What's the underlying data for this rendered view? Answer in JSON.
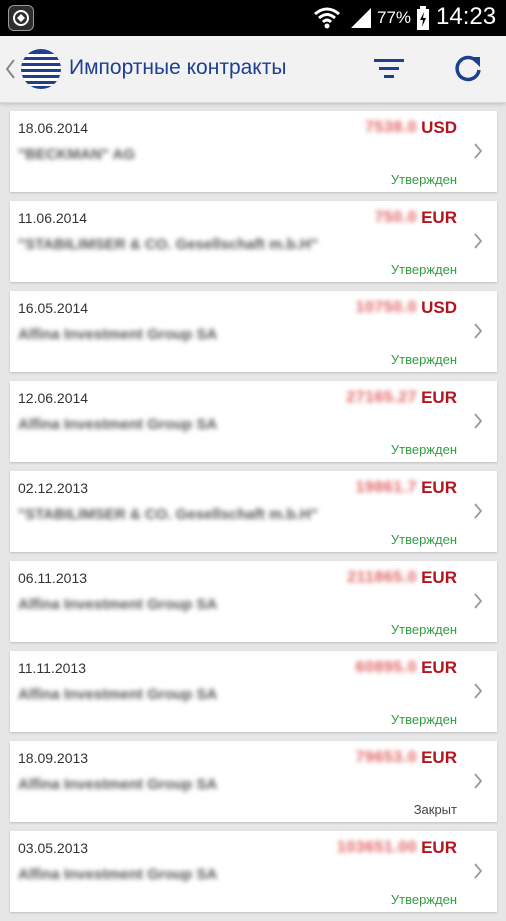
{
  "status_bar": {
    "battery": "77%",
    "time": "14:23",
    "icons": [
      "app-notification-icon",
      "wifi-icon",
      "signal-icon",
      "battery-icon"
    ]
  },
  "app_bar": {
    "title": "Импортные контракты",
    "icons": [
      "back-chevron-icon",
      "globe-logo-icon",
      "filter-icon",
      "refresh-icon"
    ],
    "accent": "#1f3f8f"
  },
  "colors": {
    "amount_currency": "#b4141e",
    "status_approved": "#2f9e3f",
    "status_closed": "#444444"
  },
  "contracts": [
    {
      "date": "18.06.2014",
      "amount": "7538.0",
      "currency": "USD",
      "counterparty": "\"BECKMAN\" AG",
      "status": "Утвержден",
      "closed": false
    },
    {
      "date": "11.06.2014",
      "amount": "750.0",
      "currency": "EUR",
      "counterparty": "\"STABILIMSER & CO. Gesellschaft m.b.H\"",
      "status": "Утвержден",
      "closed": false
    },
    {
      "date": "16.05.2014",
      "amount": "10750.0",
      "currency": "USD",
      "counterparty": "Alfina Investment Group SA",
      "status": "Утвержден",
      "closed": false
    },
    {
      "date": "12.06.2014",
      "amount": "27165.27",
      "currency": "EUR",
      "counterparty": "Alfina Investment Group SA",
      "status": "Утвержден",
      "closed": false
    },
    {
      "date": "02.12.2013",
      "amount": "19861.7",
      "currency": "EUR",
      "counterparty": "\"STABILIMSER & CO. Gesellschaft m.b.H\"",
      "status": "Утвержден",
      "closed": false
    },
    {
      "date": "06.11.2013",
      "amount": "211865.0",
      "currency": "EUR",
      "counterparty": "Alfina Investment Group SA",
      "status": "Утвержден",
      "closed": false
    },
    {
      "date": "11.11.2013",
      "amount": "60895.0",
      "currency": "EUR",
      "counterparty": "Alfina Investment Group SA",
      "status": "Утвержден",
      "closed": false
    },
    {
      "date": "18.09.2013",
      "amount": "79653.0",
      "currency": "EUR",
      "counterparty": "Alfina Investment Group SA",
      "status": "Закрыт",
      "closed": true
    },
    {
      "date": "03.05.2013",
      "amount": "103651.00",
      "currency": "EUR",
      "counterparty": "Alfina Investment Group SA",
      "status": "Утвержден",
      "closed": false
    }
  ]
}
